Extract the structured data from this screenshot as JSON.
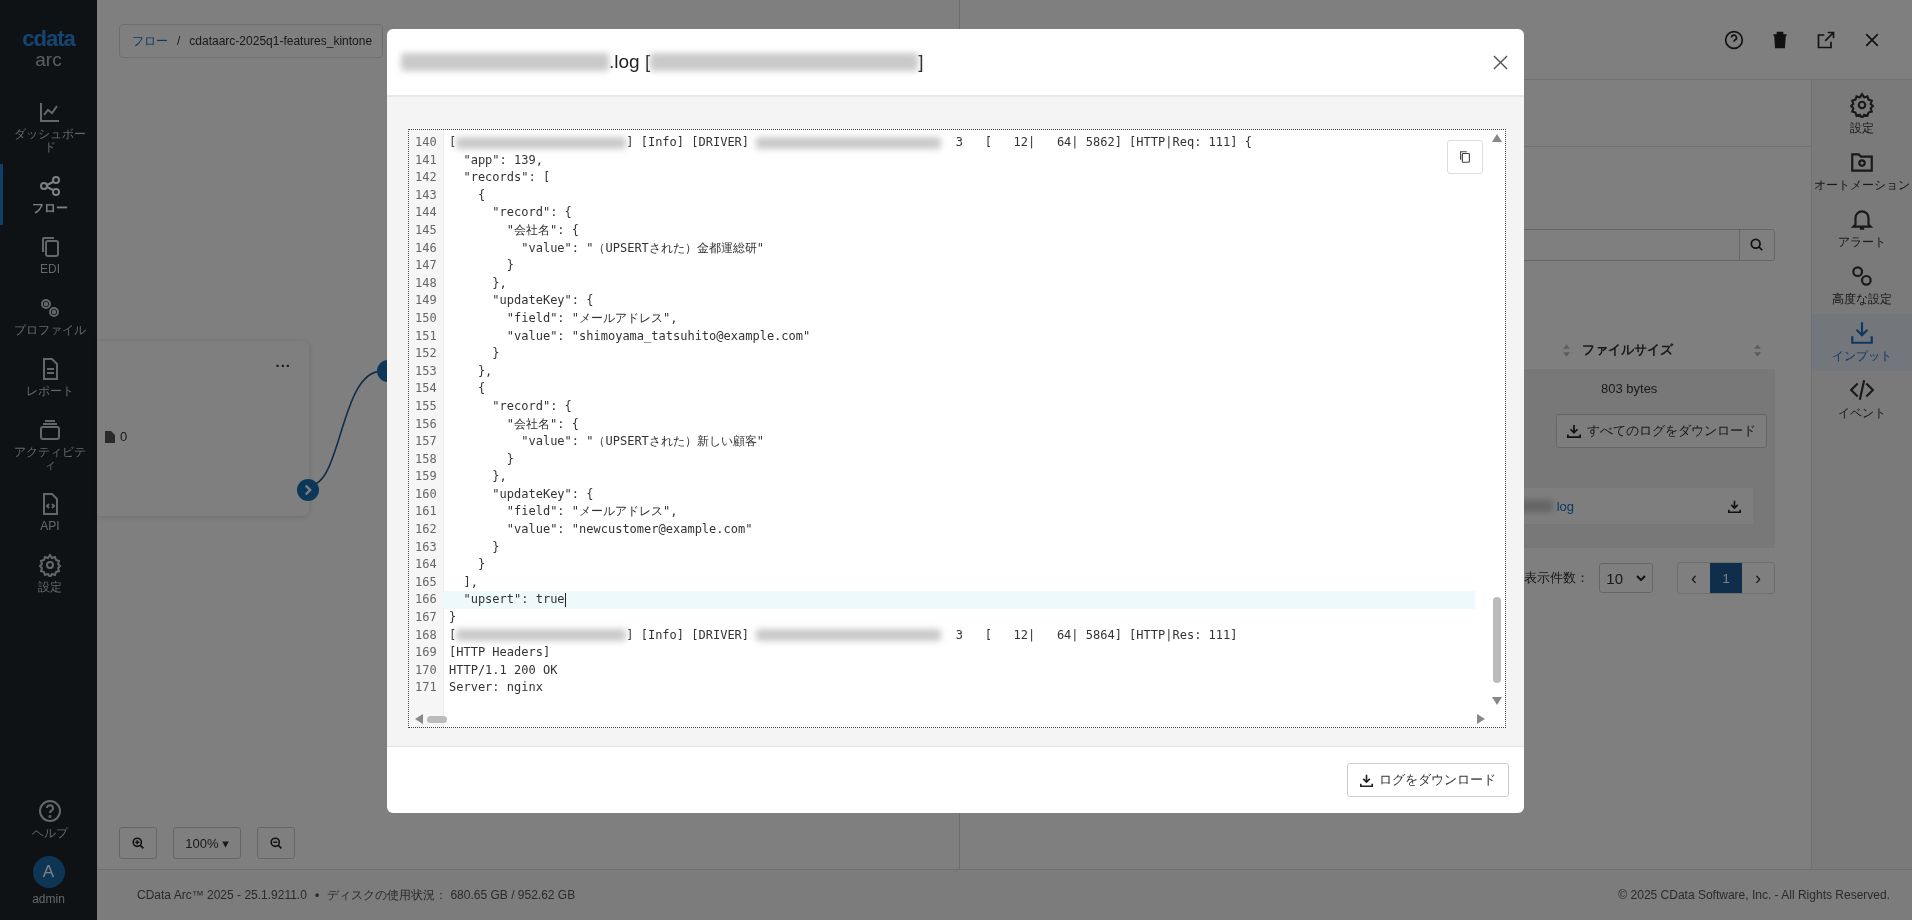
{
  "logo": {
    "brand": "cdata",
    "product": "arc"
  },
  "nav": [
    {
      "label": "ダッシュボード",
      "selected": false
    },
    {
      "label": "フロー",
      "selected": true
    },
    {
      "label": "EDI",
      "selected": false
    },
    {
      "label": "プロファイル",
      "selected": false
    },
    {
      "label": "レポート",
      "selected": false
    },
    {
      "label": "アクティビティ",
      "selected": false
    },
    {
      "label": "API",
      "selected": false
    },
    {
      "label": "設定",
      "selected": false
    }
  ],
  "help": {
    "label": "ヘルプ"
  },
  "user": {
    "initial": "A",
    "name": "admin"
  },
  "breadcrumb": {
    "root": "フロー",
    "separator": "/",
    "path": "cdataarc-2025q1-features_kintone"
  },
  "node": {
    "menu": "...",
    "file_count": "0"
  },
  "zoom": {
    "level": "100%",
    "caret": "▾"
  },
  "rail": [
    {
      "label": "設定",
      "selected": false
    },
    {
      "label": "オートメーション",
      "selected": false
    },
    {
      "label": "アラート",
      "selected": false
    },
    {
      "label": "高度な設定",
      "selected": false
    },
    {
      "label": "インプット",
      "selected": true
    },
    {
      "label": "イベント",
      "selected": false
    }
  ],
  "table": {
    "columns": [
      "ファイルサイズ"
    ],
    "size": "803 bytes",
    "download_all": "すべてのログをダウンロード",
    "log_file": "log"
  },
  "pagination": {
    "label": "表示件数：",
    "per_page": "10",
    "prev": "‹",
    "page": "1",
    "next": "›"
  },
  "footer": {
    "version": "CData Arc™ 2025 - 25.1.9211.0",
    "bullet": "•",
    "disk": "ディスクの使用状況： 680.65 GB / 952.62 GB",
    "copyright": "© 2025 CData Software, Inc. - All Rights Reserved."
  },
  "modal": {
    "title": [
      {
        "kind": "redacted"
      },
      {
        "kind": "text",
        "text": ".log ["
      },
      {
        "kind": "redacted-long"
      },
      {
        "kind": "text",
        "text": "]"
      }
    ],
    "lines": [
      {
        "no": "140",
        "active": false,
        "parts": [
          {
            "kind": "text",
            "text": "["
          },
          {
            "kind": "redacted"
          },
          {
            "kind": "text",
            "text": "] [Info] [DRIVER] "
          },
          {
            "kind": "redacted-long"
          },
          {
            "kind": "text",
            "text": "  3   [   12|   64| 5862] [HTTP|Req: 111] {"
          }
        ]
      },
      {
        "no": "141",
        "active": false,
        "parts": [
          {
            "kind": "text",
            "text": "  \"app\": 139,"
          }
        ]
      },
      {
        "no": "142",
        "active": false,
        "parts": [
          {
            "kind": "text",
            "text": "  \"records\": ["
          }
        ]
      },
      {
        "no": "143",
        "active": false,
        "parts": [
          {
            "kind": "text",
            "text": "    {"
          }
        ]
      },
      {
        "no": "144",
        "active": false,
        "parts": [
          {
            "kind": "text",
            "text": "      \"record\": {"
          }
        ]
      },
      {
        "no": "145",
        "active": false,
        "parts": [
          {
            "kind": "text",
            "text": "        \"会社名\": {"
          }
        ]
      },
      {
        "no": "146",
        "active": false,
        "parts": [
          {
            "kind": "text",
            "text": "          \"value\": \"（UPSERTされた）金都運総研\""
          }
        ]
      },
      {
        "no": "147",
        "active": false,
        "parts": [
          {
            "kind": "text",
            "text": "        }"
          }
        ]
      },
      {
        "no": "148",
        "active": false,
        "parts": [
          {
            "kind": "text",
            "text": "      },"
          }
        ]
      },
      {
        "no": "149",
        "active": false,
        "parts": [
          {
            "kind": "text",
            "text": "      \"updateKey\": {"
          }
        ]
      },
      {
        "no": "150",
        "active": false,
        "parts": [
          {
            "kind": "text",
            "text": "        \"field\": \"メールアドレス\","
          }
        ]
      },
      {
        "no": "151",
        "active": false,
        "parts": [
          {
            "kind": "text",
            "text": "        \"value\": \"shimoyama_tatsuhito@example.com\""
          }
        ]
      },
      {
        "no": "152",
        "active": false,
        "parts": [
          {
            "kind": "text",
            "text": "      }"
          }
        ]
      },
      {
        "no": "153",
        "active": false,
        "parts": [
          {
            "kind": "text",
            "text": "    },"
          }
        ]
      },
      {
        "no": "154",
        "active": false,
        "parts": [
          {
            "kind": "text",
            "text": "    {"
          }
        ]
      },
      {
        "no": "155",
        "active": false,
        "parts": [
          {
            "kind": "text",
            "text": "      \"record\": {"
          }
        ]
      },
      {
        "no": "156",
        "active": false,
        "parts": [
          {
            "kind": "text",
            "text": "        \"会社名\": {"
          }
        ]
      },
      {
        "no": "157",
        "active": false,
        "parts": [
          {
            "kind": "text",
            "text": "          \"value\": \"（UPSERTされた）新しい顧客\""
          }
        ]
      },
      {
        "no": "158",
        "active": false,
        "parts": [
          {
            "kind": "text",
            "text": "        }"
          }
        ]
      },
      {
        "no": "159",
        "active": false,
        "parts": [
          {
            "kind": "text",
            "text": "      },"
          }
        ]
      },
      {
        "no": "160",
        "active": false,
        "parts": [
          {
            "kind": "text",
            "text": "      \"updateKey\": {"
          }
        ]
      },
      {
        "no": "161",
        "active": false,
        "parts": [
          {
            "kind": "text",
            "text": "        \"field\": \"メールアドレス\","
          }
        ]
      },
      {
        "no": "162",
        "active": false,
        "parts": [
          {
            "kind": "text",
            "text": "        \"value\": \"newcustomer@example.com\""
          }
        ]
      },
      {
        "no": "163",
        "active": false,
        "parts": [
          {
            "kind": "text",
            "text": "      }"
          }
        ]
      },
      {
        "no": "164",
        "active": false,
        "parts": [
          {
            "kind": "text",
            "text": "    }"
          }
        ]
      },
      {
        "no": "165",
        "active": false,
        "parts": [
          {
            "kind": "text",
            "text": "  ],"
          }
        ]
      },
      {
        "no": "166",
        "active": true,
        "parts": [
          {
            "kind": "text",
            "text": "  \"upsert\": true"
          }
        ]
      },
      {
        "no": "167",
        "active": false,
        "parts": [
          {
            "kind": "text",
            "text": "}"
          }
        ]
      },
      {
        "no": "168",
        "active": false,
        "parts": [
          {
            "kind": "text",
            "text": "["
          },
          {
            "kind": "redacted"
          },
          {
            "kind": "text",
            "text": "] [Info] [DRIVER] "
          },
          {
            "kind": "redacted-long"
          },
          {
            "kind": "text",
            "text": "  3   [   12|   64| 5864] [HTTP|Res: 111]"
          }
        ]
      },
      {
        "no": "169",
        "active": false,
        "parts": [
          {
            "kind": "text",
            "text": "[HTTP Headers]"
          }
        ]
      },
      {
        "no": "170",
        "active": false,
        "parts": [
          {
            "kind": "text",
            "text": "HTTP/1.1 200 OK"
          }
        ]
      },
      {
        "no": "171",
        "active": false,
        "parts": [
          {
            "kind": "text",
            "text": "Server: nginx"
          }
        ]
      }
    ],
    "download": "ログをダウンロード"
  }
}
